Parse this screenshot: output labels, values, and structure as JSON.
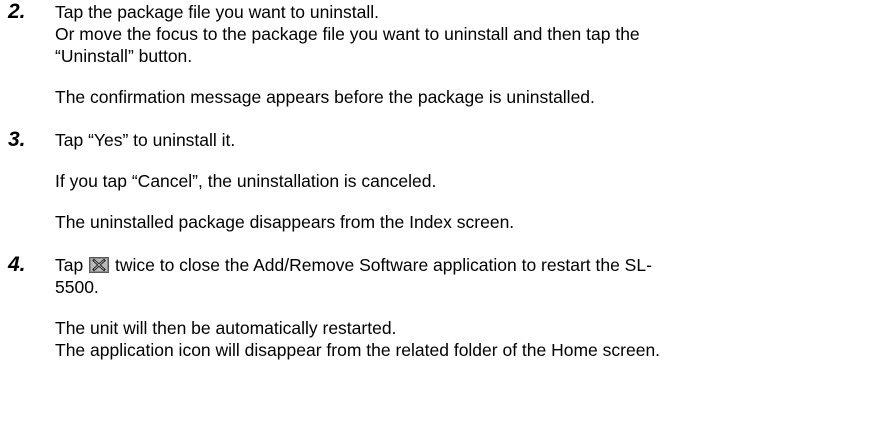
{
  "steps": [
    {
      "number": "2.",
      "lines": [
        "Tap the package file you want to uninstall.",
        "Or move the focus to the package file you want to uninstall and then tap the",
        "“Uninstall” button."
      ],
      "note": "The confirmation message appears before the package is uninstalled."
    },
    {
      "number": "3.",
      "text": "Tap “Yes” to uninstall it.",
      "notes": [
        "If you tap “Cancel”, the uninstallation is canceled.",
        "The uninstalled package disappears from the Index screen."
      ]
    },
    {
      "number": "4.",
      "text_before_icon": "Tap",
      "icon": "close-x-icon",
      "text_after_icon": "twice to close the Add/Remove Software application to restart the SL-",
      "text_line2": "5500.",
      "notes": [
        "The unit will then be automatically restarted.",
        "The application icon will disappear from the related folder of the Home screen."
      ]
    }
  ]
}
